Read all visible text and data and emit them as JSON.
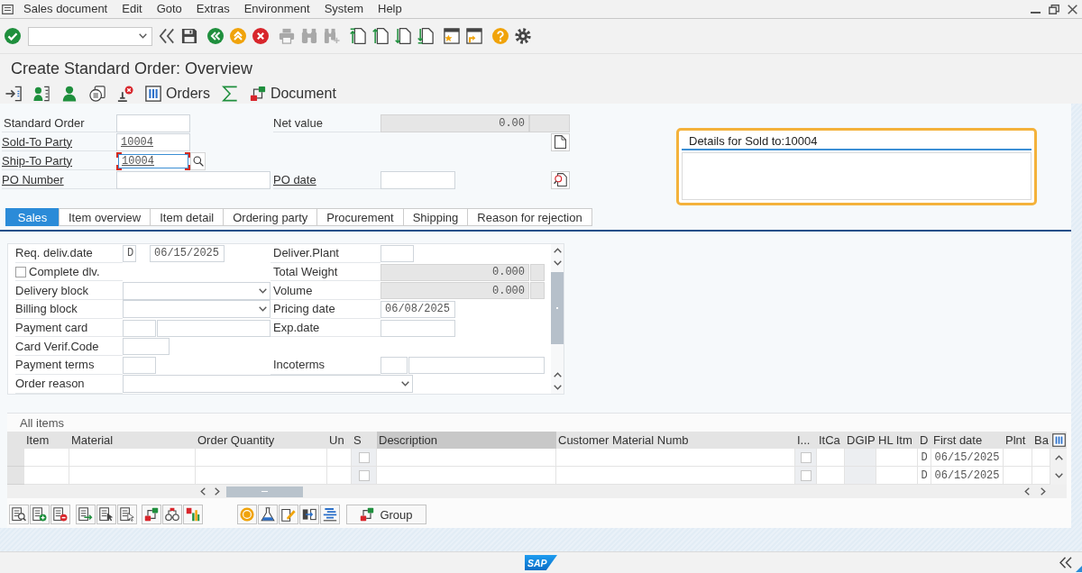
{
  "menu_bar": {
    "items": [
      "Sales document",
      "Edit",
      "Goto",
      "Extras",
      "Environment",
      "System",
      "Help"
    ]
  },
  "toolbar": {
    "groups": [
      [
        {
          "kind": "enter",
          "disabled": false
        }
      ],
      [
        {
          "kind": "hide",
          "disabled": false
        },
        {
          "kind": "save",
          "disabled": false
        }
      ],
      [
        {
          "kind": "back",
          "disabled": false
        },
        {
          "kind": "exit",
          "disabled": false
        },
        {
          "kind": "cancel",
          "disabled": false
        }
      ],
      [
        {
          "kind": "print",
          "disabled": true
        },
        {
          "kind": "find",
          "disabled": true
        },
        {
          "kind": "find-next",
          "disabled": true
        }
      ],
      [
        {
          "kind": "first-page",
          "disabled": false
        },
        {
          "kind": "previous-page",
          "disabled": false
        },
        {
          "kind": "next-page",
          "disabled": false
        },
        {
          "kind": "last-page",
          "disabled": false
        }
      ],
      [
        {
          "kind": "new-session",
          "disabled": false
        },
        {
          "kind": "shortcut",
          "disabled": false
        }
      ],
      [
        {
          "kind": "help",
          "disabled": false
        },
        {
          "kind": "settings",
          "disabled": false
        }
      ]
    ]
  },
  "title": "Create Standard Order: Overview",
  "app_toolbar": {
    "buttons": [
      {
        "kind": "import"
      },
      {
        "kind": "partner-list"
      },
      {
        "kind": "person"
      },
      {
        "kind": "display"
      },
      {
        "kind": "stamp-error"
      },
      {
        "kind": "table",
        "label": "Orders"
      },
      {
        "kind": "sum"
      },
      {
        "kind": "hierarchy",
        "label": "Document"
      }
    ]
  },
  "header": {
    "rows": [
      {
        "left": {
          "kind": "short",
          "label": "Standard Order",
          "link": false,
          "focused": false
        },
        "right": {
          "kind": "readonly",
          "label": "Net value",
          "link": false,
          "value": "0.00"
        }
      },
      {
        "left": {
          "kind": "short",
          "label": "Sold-To Party",
          "link": true,
          "focused": false,
          "value": "10004"
        },
        "button": {
          "kind": "document"
        }
      },
      {
        "left": {
          "kind": "short",
          "label": "Ship-To Party",
          "link": true,
          "focused": true,
          "value": "10004"
        }
      },
      {
        "left": {
          "kind": "wide",
          "label": "PO Number",
          "link": true,
          "focused": false
        },
        "right": {
          "kind": "date",
          "label": "PO date",
          "link": true
        },
        "button": {
          "kind": "document-search"
        }
      }
    ]
  },
  "details": {
    "title": "Details for Sold to:10004"
  },
  "tabs": [
    {
      "label": "Sales",
      "selected": true
    },
    {
      "label": "Item overview",
      "selected": false
    },
    {
      "label": "Item detail",
      "selected": false
    },
    {
      "label": "Ordering party",
      "selected": false
    },
    {
      "label": "Procurement",
      "selected": false
    },
    {
      "label": "Shipping",
      "selected": false
    },
    {
      "label": "Reason for rejection",
      "selected": false
    }
  ],
  "sales": {
    "rows": [
      {
        "left": {
          "kind": "date",
          "label": "Req. deliv.date",
          "code": "D",
          "value": "06/15/2025"
        },
        "right": {
          "kind": "short",
          "label": "Deliver.Plant"
        }
      },
      {
        "left": {
          "kind": "checkbox",
          "label": "Complete dlv.",
          "checked": false
        },
        "right": {
          "kind": "readonly",
          "label": "Total Weight",
          "value": "0.000"
        }
      },
      {
        "left": {
          "kind": "dropdown",
          "label": "Delivery block"
        },
        "right": {
          "kind": "readonly",
          "label": "Volume",
          "value": "0.000"
        }
      },
      {
        "left": {
          "kind": "dropdown",
          "label": "Billing block"
        },
        "right": {
          "kind": "date",
          "label": "Pricing date",
          "value": "06/08/2025"
        }
      },
      {
        "left": {
          "kind": "pair",
          "label": "Payment card"
        },
        "right": {
          "kind": "date",
          "label": "Exp.date"
        }
      },
      {
        "left": {
          "kind": "medium",
          "label": "Card Verif.Code"
        }
      },
      {
        "left": {
          "kind": "short",
          "label": "Payment terms"
        },
        "right": {
          "kind": "pair",
          "label": "Incoterms"
        }
      },
      {
        "left": {
          "kind": "wide-dropdown",
          "label": "Order reason"
        }
      }
    ]
  },
  "items": {
    "title": "All items",
    "columns": [
      {
        "label": "Item",
        "selected": false,
        "readonly": false
      },
      {
        "label": "Material",
        "selected": false,
        "readonly": false
      },
      {
        "label": "Order Quantity",
        "selected": false,
        "readonly": false
      },
      {
        "label": "Un",
        "selected": false,
        "readonly": false
      },
      {
        "label": "S",
        "selected": false,
        "readonly": true
      },
      {
        "label": "Description",
        "selected": true,
        "readonly": false
      },
      {
        "label": "Customer Material Numb",
        "selected": false,
        "readonly": false
      },
      {
        "label": "I...",
        "selected": false,
        "readonly": true
      },
      {
        "label": "ItCa",
        "selected": false,
        "readonly": false
      },
      {
        "label": "DGIP",
        "selected": false,
        "readonly": true
      },
      {
        "label": "HL Itm",
        "selected": false,
        "readonly": false
      },
      {
        "label": "D",
        "selected": false,
        "readonly": false
      },
      {
        "label": "First date",
        "selected": false,
        "readonly": false
      },
      {
        "label": "Plnt",
        "selected": false,
        "readonly": false
      },
      {
        "label": "Ba",
        "selected": false,
        "readonly": false
      }
    ],
    "rows": [
      {
        "s_checked": false,
        "i_checked": false,
        "d": "D",
        "first_date": "06/15/2025"
      },
      {
        "s_checked": false,
        "i_checked": false,
        "d": "D",
        "first_date": "06/15/2025"
      }
    ]
  },
  "items_toolbar": {
    "groups": [
      [
        {
          "kind": "details"
        },
        {
          "kind": "insert-row"
        },
        {
          "kind": "delete-row"
        }
      ],
      [
        {
          "kind": "select-all"
        },
        {
          "kind": "select-block"
        },
        {
          "kind": "deselect-all"
        }
      ],
      [
        {
          "kind": "configure"
        },
        {
          "kind": "glasses"
        },
        {
          "kind": "chart"
        }
      ],
      [
        {
          "kind": "coin"
        },
        {
          "kind": "flask"
        },
        {
          "kind": "notes"
        },
        {
          "kind": "transfer"
        },
        {
          "kind": "align"
        }
      ],
      [
        {
          "kind": "group",
          "label": "Group"
        }
      ]
    ]
  },
  "footer": {
    "logo": "SAP"
  }
}
